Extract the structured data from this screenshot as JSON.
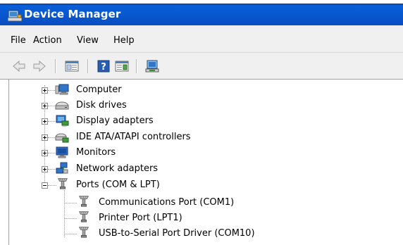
{
  "window": {
    "title": "Device Manager"
  },
  "menu": {
    "items": [
      "File",
      "Action",
      "View",
      "Help"
    ]
  },
  "toolbar": {
    "buttons": [
      "back-icon",
      "forward-icon",
      "properties-icon",
      "help-icon",
      "show-hide-icon",
      "scan-hardware-icon"
    ]
  },
  "tree": {
    "categories": [
      {
        "label": "Computer",
        "icon": "computer-icon",
        "expanded": false
      },
      {
        "label": "Disk drives",
        "icon": "disk-drive-icon",
        "expanded": false
      },
      {
        "label": "Display adapters",
        "icon": "display-adapter-icon",
        "expanded": false
      },
      {
        "label": "IDE ATA/ATAPI controllers",
        "icon": "ide-controller-icon",
        "expanded": false
      },
      {
        "label": "Monitors",
        "icon": "monitor-icon",
        "expanded": false
      },
      {
        "label": "Network adapters",
        "icon": "network-adapter-icon",
        "expanded": false
      },
      {
        "label": "Ports (COM & LPT)",
        "icon": "port-icon",
        "expanded": true
      }
    ],
    "ports_children": [
      {
        "label": "Communications Port (COM1)",
        "icon": "port-icon"
      },
      {
        "label": "Printer Port (LPT1)",
        "icon": "port-icon"
      },
      {
        "label": "USB-to-Serial Port Driver (COM10)",
        "icon": "port-icon"
      }
    ]
  }
}
